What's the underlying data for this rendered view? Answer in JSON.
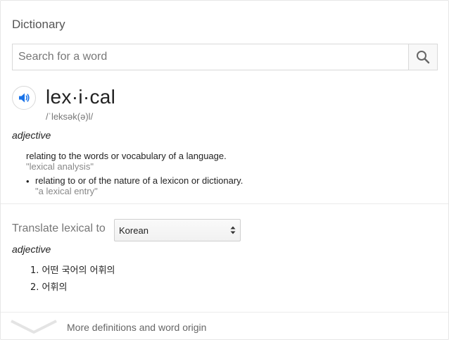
{
  "header": {
    "title": "Dictionary"
  },
  "search": {
    "placeholder": "Search for a word",
    "icon": "search-icon"
  },
  "entry": {
    "word": "lex·i·cal",
    "phonetic": "/ˈleksək(ə)l/",
    "part_of_speech": "adjective",
    "definitions": [
      {
        "text": "relating to the words or vocabulary of a language.",
        "example": "\"lexical analysis\""
      },
      {
        "text": "relating to or of the nature of a lexicon or dictionary.",
        "example": "\"a lexical entry\""
      }
    ],
    "bullet": "•"
  },
  "translate": {
    "label": "Translate lexical to",
    "selected_language": "Korean",
    "part_of_speech": "adjective",
    "items": [
      {
        "num": "1.",
        "text": "어떤 국어의 어휘의"
      },
      {
        "num": "2.",
        "text": "어휘의"
      }
    ]
  },
  "footer": {
    "more_label": "More definitions and word origin"
  },
  "colors": {
    "accent": "#1a73e8",
    "muted": "#777777",
    "example": "#888888",
    "border": "#d9d9d9"
  }
}
